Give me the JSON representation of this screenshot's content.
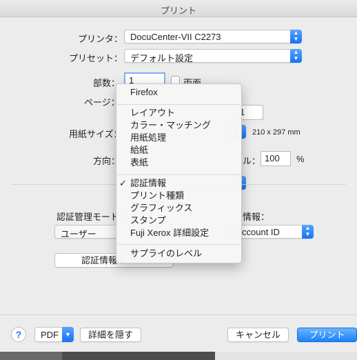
{
  "window": {
    "title": "プリント"
  },
  "printer": {
    "label": "プリンタ：",
    "value": "DocuCenter-VII C2273"
  },
  "preset": {
    "label": "プリセット：",
    "value": "デフォルト設定"
  },
  "copies": {
    "label": "部数：",
    "value": "1",
    "duplex_label": "両面"
  },
  "pages": {
    "label": "ページ：",
    "to_value": "1"
  },
  "paper": {
    "label": "用紙サイズ：",
    "dimensions": "210 x 297 mm"
  },
  "orientation": {
    "label": "方向：",
    "scale_label_partial": "ル：",
    "scale_value": "100",
    "scale_unit": "%"
  },
  "auth": {
    "mode_label": "認証管理モード：",
    "mode_value": "ユーザー",
    "info_label": "情報：",
    "info_value": "ccount ID",
    "button_label": "認証情報の"
  },
  "menu": {
    "items": [
      {
        "label": "Firefox",
        "checked": false
      },
      {
        "label": "レイアウト",
        "checked": false
      },
      {
        "label": "カラー・マッチング",
        "checked": false
      },
      {
        "label": "用紙処理",
        "checked": false
      },
      {
        "label": "給紙",
        "checked": false
      },
      {
        "label": "表紙",
        "checked": false
      },
      {
        "label": "認証情報",
        "checked": true
      },
      {
        "label": "プリント種類",
        "checked": false
      },
      {
        "label": "グラフィックス",
        "checked": false
      },
      {
        "label": "スタンプ",
        "checked": false
      },
      {
        "label": "Fuji Xerox 詳細設定",
        "checked": false
      },
      {
        "label": "サプライのレベル",
        "checked": false
      }
    ],
    "check_mark": "✓"
  },
  "footer": {
    "help": "?",
    "pdf": "PDF",
    "hide_details": "詳細を隠す",
    "cancel": "キャンセル",
    "print": "プリント"
  },
  "colors": {
    "accent": "#1a82fb",
    "window_bg": "#ececec"
  }
}
